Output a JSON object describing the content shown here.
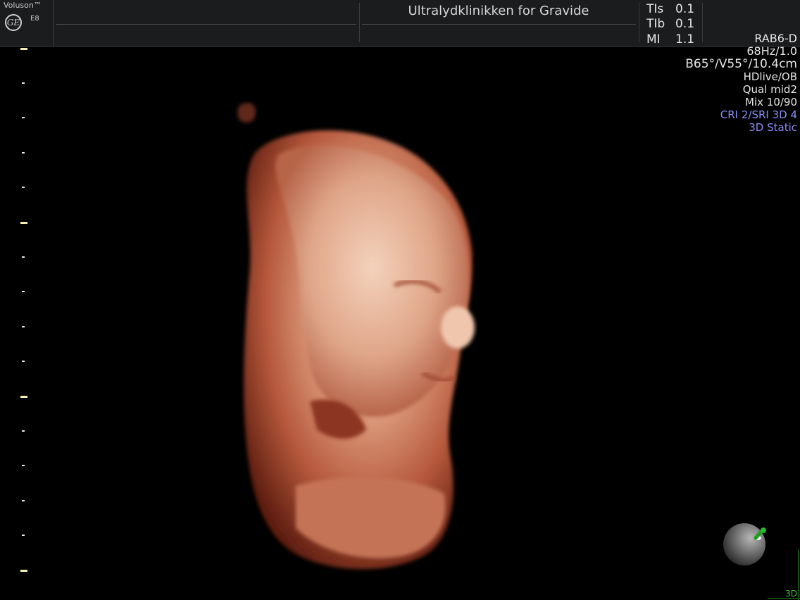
{
  "header": {
    "brand": "Voluson™",
    "logo_text": "GE",
    "model": "E8",
    "clinic": "Ultralydklinikken for Gravide",
    "indices": [
      {
        "label": "TIs",
        "value": "0.1"
      },
      {
        "label": "TIb",
        "value": "0.1"
      },
      {
        "label": "MI",
        "value": "1.1"
      }
    ]
  },
  "settings": {
    "probe": "RAB6-D",
    "frame_rate": "68Hz/1.0",
    "geometry": "B65°/V55°/10.4cm",
    "preset": "HDlive/OB",
    "quality": "Qual mid2",
    "mix": "Mix 10/90",
    "cri": "CRI 2/SRI 3D 4",
    "mode": "3D Static"
  },
  "footer": {
    "mode_label": "3D"
  },
  "colors": {
    "background": "#000000",
    "header_bg": "#1b1c1e",
    "accent_blue": "#8a8cf5",
    "orientation_green": "#22b422",
    "render_skin": "#d9987a"
  },
  "icons": {
    "logo": "ge-logo-icon",
    "orientation": "orientation-sphere-icon"
  }
}
